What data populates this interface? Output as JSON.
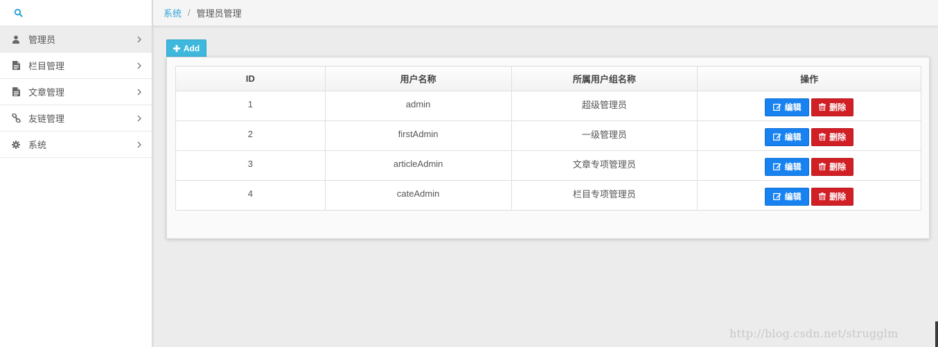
{
  "breadcrumb": {
    "parent": "系统",
    "separator": "/",
    "current": "管理员管理"
  },
  "sidebar": {
    "search_icon": "search-icon",
    "items": [
      {
        "label": "管理员",
        "icon": "user-icon",
        "active": true
      },
      {
        "label": "栏目管理",
        "icon": "file-icon",
        "active": false
      },
      {
        "label": "文章管理",
        "icon": "file-icon",
        "active": false
      },
      {
        "label": "友链管理",
        "icon": "link-icon",
        "active": false
      },
      {
        "label": "系统",
        "icon": "gear-icon",
        "active": false
      }
    ]
  },
  "toolbar": {
    "add_label": "Add"
  },
  "table": {
    "columns": [
      "ID",
      "用户名称",
      "所属用户组名称",
      "操作"
    ],
    "rows": [
      {
        "id": "1",
        "name": "admin",
        "group": "超级管理员"
      },
      {
        "id": "2",
        "name": "firstAdmin",
        "group": "一级管理员"
      },
      {
        "id": "3",
        "name": "articleAdmin",
        "group": "文章专项管理员"
      },
      {
        "id": "4",
        "name": "cateAdmin",
        "group": "栏目专项管理员"
      }
    ],
    "edit_label": "编辑",
    "delete_label": "删除"
  },
  "watermark": "http://blog.csdn.net/strugglm",
  "colors": {
    "accent": "#2fa4d7",
    "add": "#3fb8dd",
    "edit": "#1883f0",
    "delete": "#d11f26"
  }
}
